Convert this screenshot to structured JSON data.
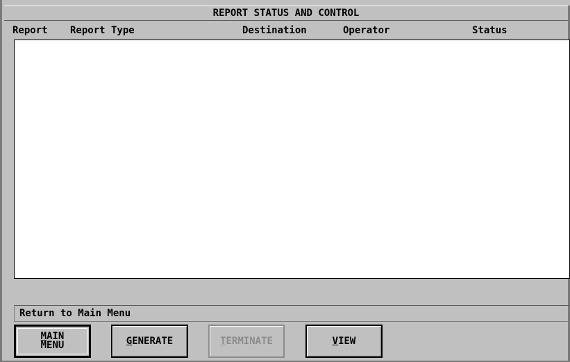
{
  "window": {
    "title": "REPORT STATUS AND CONTROL"
  },
  "table": {
    "columns": [
      "Report",
      "Report Type",
      "Destination",
      "Operator",
      "Status"
    ],
    "rows": []
  },
  "status_bar": {
    "text": "Return to Main Menu"
  },
  "buttons": {
    "main_menu": {
      "line1": "MAIN",
      "line2": "MENU",
      "accel": "M",
      "default": true,
      "enabled": true
    },
    "generate": {
      "accel": "G",
      "rest": "ENERATE",
      "enabled": true
    },
    "terminate": {
      "accel": "T",
      "rest": "ERMINATE",
      "enabled": false
    },
    "view": {
      "accel": "V",
      "rest": "IEW",
      "enabled": true
    }
  }
}
